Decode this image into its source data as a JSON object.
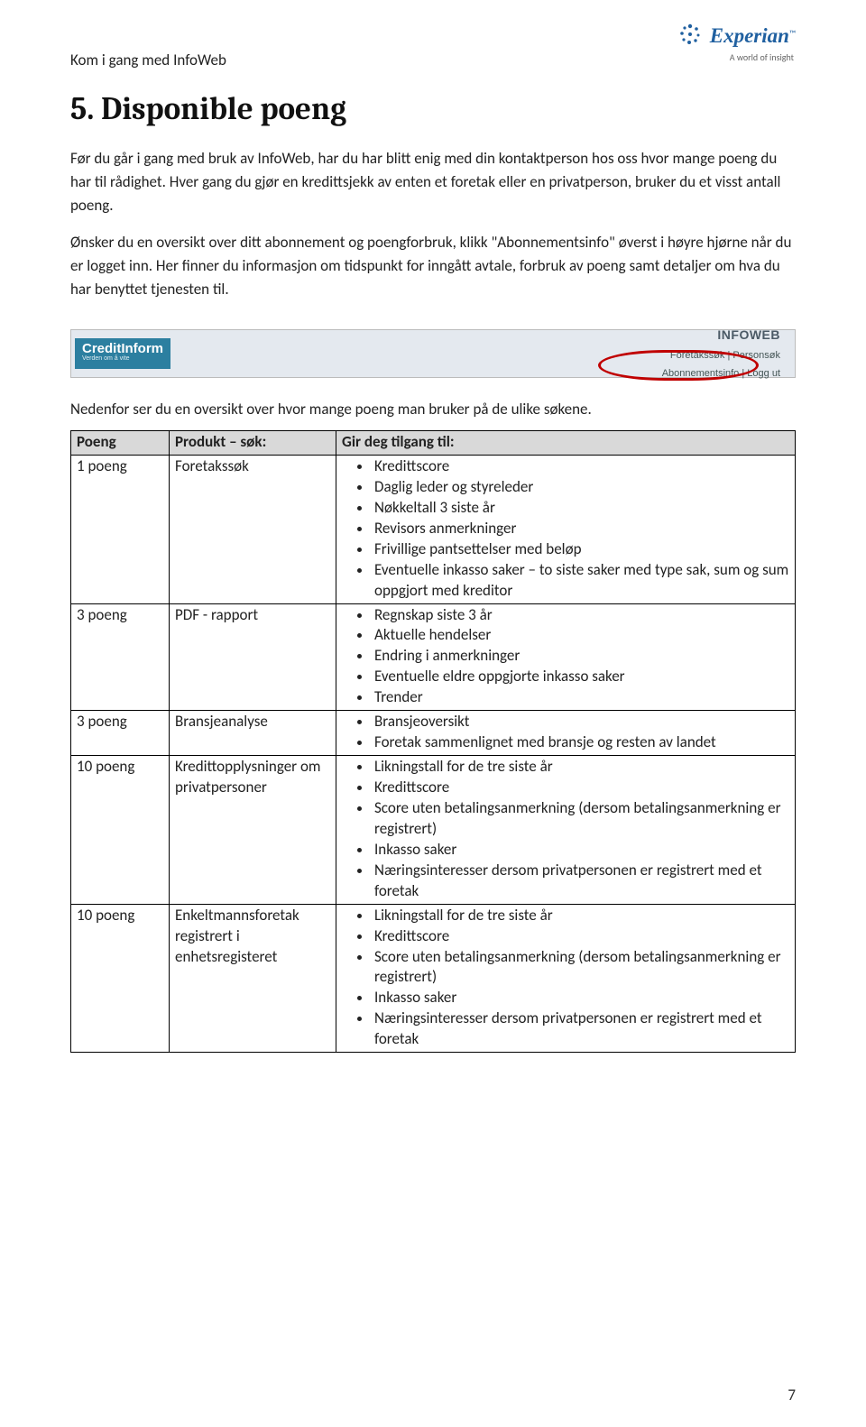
{
  "header": {
    "doc_title": "Kom i gang med InfoWeb",
    "logo_brand": "Experian",
    "logo_tagline": "A world of insight"
  },
  "heading": "5. Disponible poeng",
  "paragraphs": {
    "p1": "Før du går i gang med bruk av InfoWeb, har du har blitt enig med din kontaktperson hos oss hvor mange poeng du har til rådighet. Hver gang du gjør en kredittsjekk av enten et foretak eller en privatperson, bruker du et visst antall poeng.",
    "p2": "Ønsker du en oversikt over ditt abonnement og poengforbruk, klikk \"Abonnementsinfo\" øverst i høyre hjørne når du er logget inn. Her finner du informasjon om tidspunkt for inngått avtale, forbruk av poeng samt detaljer om hva du har benyttet tjenesten til."
  },
  "banner": {
    "ci_name": "CreditInform",
    "ci_sub": "Verden om å vite",
    "info_title": "INFOWEB",
    "row1": {
      "a": "Foretakssøk",
      "sep": " | ",
      "b": "Personsøk"
    },
    "row2": {
      "a": "Abonnementsinfo",
      "sep": " | ",
      "b": "Logg ut"
    }
  },
  "sub_intro": "Nedenfor ser du en oversikt over hvor mange poeng man bruker på de ulike søkene.",
  "table": {
    "headers": {
      "h1": "Poeng",
      "h2": "Produkt – søk:",
      "h3": "Gir deg tilgang til:"
    },
    "rows": [
      {
        "poeng": "1 poeng",
        "produkt": "Foretakssøk",
        "items": [
          "Kredittscore",
          "Daglig leder og styreleder",
          "Nøkkeltall 3 siste år",
          "Revisors anmerkninger",
          "Frivillige pantsettelser med beløp",
          "Eventuelle inkasso saker – to siste saker med type sak, sum og sum oppgjort med kreditor"
        ]
      },
      {
        "poeng": "3 poeng",
        "produkt": "PDF - rapport",
        "items": [
          "Regnskap siste 3 år",
          "Aktuelle hendelser",
          "Endring i anmerkninger",
          "Eventuelle eldre oppgjorte inkasso saker",
          "Trender"
        ]
      },
      {
        "poeng": "3 poeng",
        "produkt": "Bransjeanalyse",
        "items": [
          "Bransjeoversikt",
          "Foretak sammenlignet med bransje og resten av landet"
        ]
      },
      {
        "poeng": "10 poeng",
        "produkt": "Kredittopplysninger om privatpersoner",
        "items": [
          "Likningstall for de tre siste år",
          "Kredittscore",
          "Score uten betalingsanmerkning (dersom betalingsanmerkning er registrert)",
          "Inkasso saker",
          "Næringsinteresser dersom privatpersonen er registrert med et foretak"
        ]
      },
      {
        "poeng": "10 poeng",
        "produkt": "Enkeltmannsforetak registrert i enhetsregisteret",
        "items": [
          "Likningstall for de tre siste år",
          "Kredittscore",
          "Score uten betalingsanmerkning (dersom betalingsanmerkning er registrert)",
          "Inkasso saker",
          "Næringsinteresser dersom privatpersonen er registrert med et foretak"
        ]
      }
    ]
  },
  "page_number": "7"
}
